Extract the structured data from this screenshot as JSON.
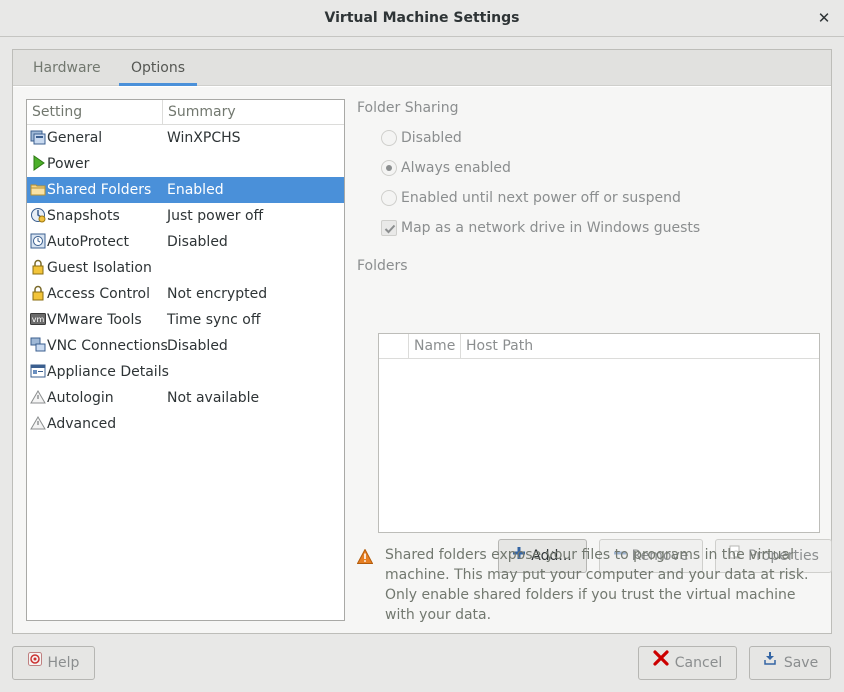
{
  "window": {
    "title": "Virtual Machine Settings",
    "close_glyph": "✕"
  },
  "tabs": [
    {
      "label": "Hardware",
      "active": false
    },
    {
      "label": "Options",
      "active": true
    }
  ],
  "settings_tree": {
    "headers": {
      "setting": "Setting",
      "summary": "Summary"
    },
    "rows": [
      {
        "label": "General",
        "summary": "WinXPCHS",
        "icon": "general-icon"
      },
      {
        "label": "Power",
        "summary": "",
        "icon": "power-icon"
      },
      {
        "label": "Shared Folders",
        "summary": "Enabled",
        "icon": "folder-icon",
        "selected": true
      },
      {
        "label": "Snapshots",
        "summary": "Just power off",
        "icon": "snapshot-icon"
      },
      {
        "label": "AutoProtect",
        "summary": "Disabled",
        "icon": "autoprotect-icon"
      },
      {
        "label": "Guest Isolation",
        "summary": "",
        "icon": "lock-icon"
      },
      {
        "label": "Access Control",
        "summary": "Not encrypted",
        "icon": "lock-icon"
      },
      {
        "label": "VMware Tools",
        "summary": "Time sync off",
        "icon": "vmware-tools-icon"
      },
      {
        "label": "VNC Connections",
        "summary": "Disabled",
        "icon": "vnc-icon"
      },
      {
        "label": "Appliance Details",
        "summary": "",
        "icon": "appliance-icon"
      },
      {
        "label": "Autologin",
        "summary": "Not available",
        "icon": "autologin-icon"
      },
      {
        "label": "Advanced",
        "summary": "",
        "icon": "advanced-icon"
      }
    ]
  },
  "folder_sharing": {
    "title": "Folder Sharing",
    "options": [
      {
        "label": "Disabled",
        "checked": false
      },
      {
        "label": "Always enabled",
        "checked": true
      },
      {
        "label": "Enabled until next power off or suspend",
        "checked": false
      }
    ],
    "map_drive": {
      "label": "Map as a network drive in Windows guests",
      "checked": true
    }
  },
  "folders": {
    "title": "Folders",
    "columns": [
      "",
      "Name",
      "Host Path"
    ],
    "rows": [],
    "buttons": {
      "add": "Add...",
      "remove": "Remove",
      "properties": "Properties"
    }
  },
  "warning": {
    "text": "Shared folders expose your files to programs in the virtual machine. This may put your computer and your data at risk. Only enable shared folders if you trust the virtual machine with your data."
  },
  "footer": {
    "help": "Help",
    "cancel": "Cancel",
    "save": "Save"
  },
  "colors": {
    "accent": "#4a90d9",
    "window_bg": "#e8e8e7",
    "warning": "#e67e22",
    "cancel_icon": "#cc0000"
  }
}
